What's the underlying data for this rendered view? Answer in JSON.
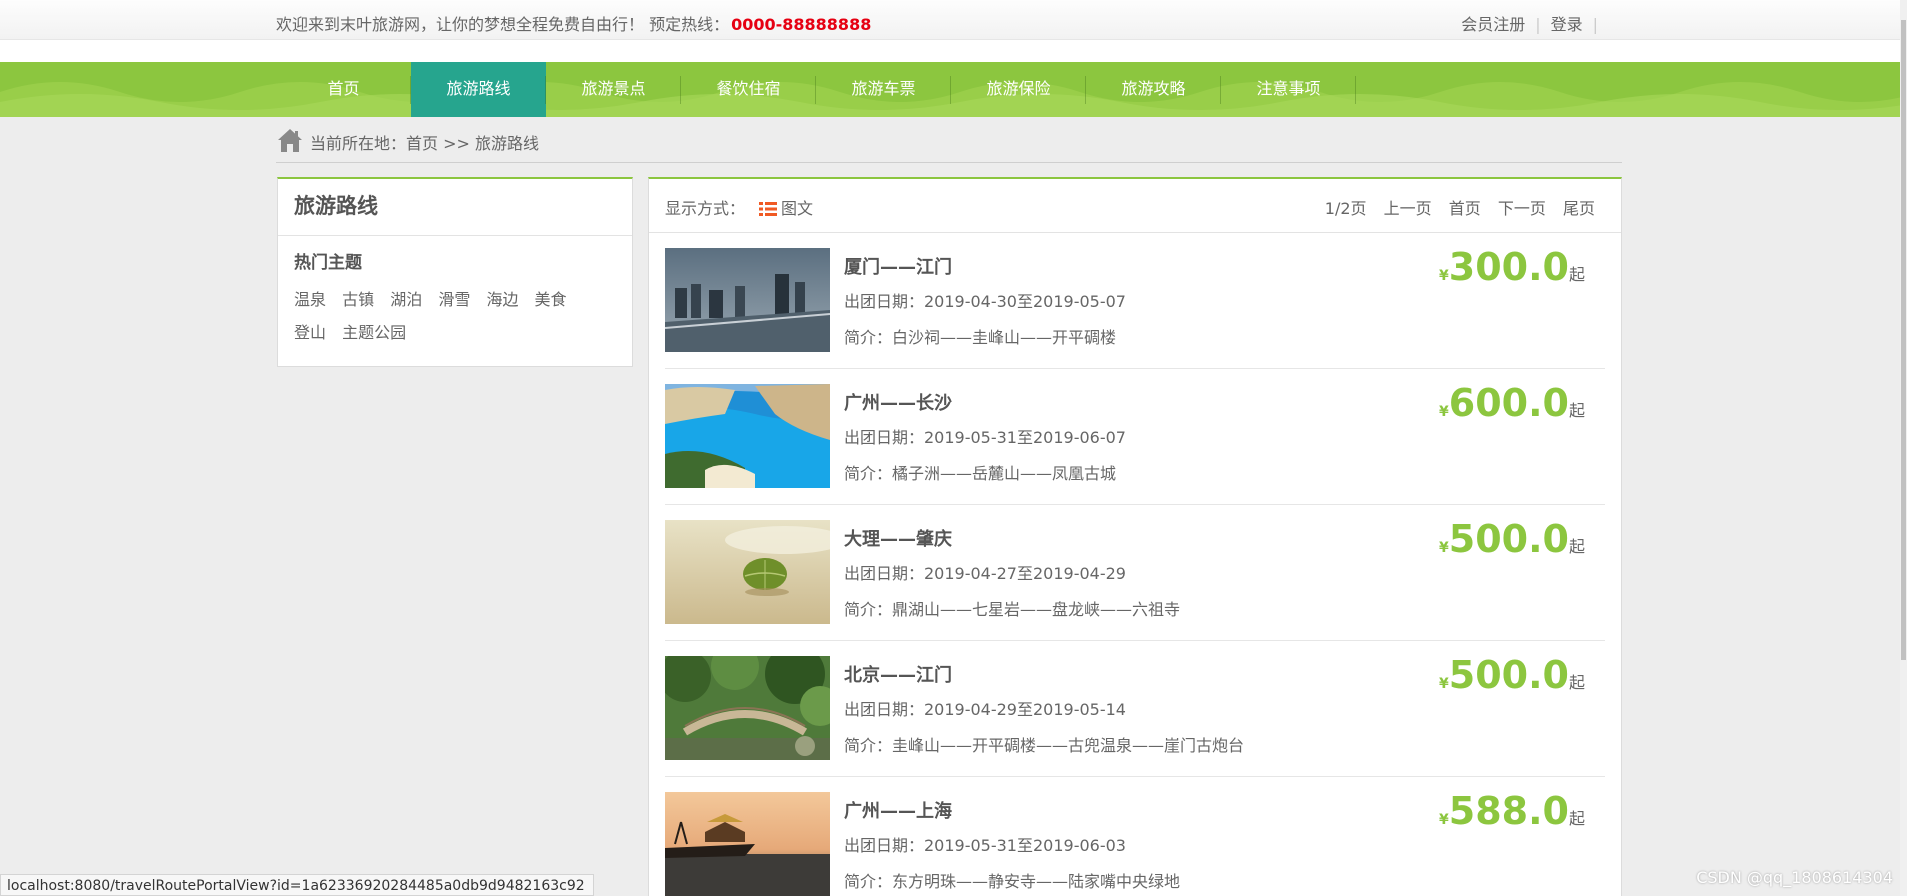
{
  "topbar": {
    "welcome": "欢迎来到末叶旅游网，让你的梦想全程免费自由行！  预定热线：",
    "hotline": "0000-88888888",
    "register": "会员注册",
    "login": "登录",
    "separator": "|"
  },
  "nav": {
    "items": [
      {
        "label": "首页"
      },
      {
        "label": "旅游路线"
      },
      {
        "label": "旅游景点"
      },
      {
        "label": "餐饮住宿"
      },
      {
        "label": "旅游车票"
      },
      {
        "label": "旅游保险"
      },
      {
        "label": "旅游攻略"
      },
      {
        "label": "注意事项"
      }
    ],
    "active": "旅游路线"
  },
  "breadcrumb": {
    "text": "当前所在地：首页 >> 旅游路线",
    "icon": "home-icon"
  },
  "sidebar": {
    "title": "旅游路线",
    "subtitle": "热门主题",
    "tags": [
      "温泉",
      "古镇",
      "湖泊",
      "滑雪",
      "海边",
      "美食",
      "登山",
      "主题公园"
    ]
  },
  "main": {
    "view_label": "显示方式：",
    "view_mode": "图文",
    "pager": {
      "page": "1/2页",
      "prev": "上一页",
      "first": "首页",
      "next": "下一页",
      "last": "尾页"
    },
    "routes": [
      {
        "title": "厦门——江门",
        "date": "出团日期：2019-04-30至2019-05-07",
        "desc": "简介：白沙祠——圭峰山——开平碉楼",
        "currency": "¥",
        "price": "300.0",
        "suffix": "起",
        "image": "city-bridge-photo"
      },
      {
        "title": "广州——长沙",
        "date": "出团日期：2019-05-31至2019-06-07",
        "desc": "简介：橘子洲——岳麓山——凤凰古城",
        "currency": "¥",
        "price": "600.0",
        "suffix": "起",
        "image": "beach-cove-photo"
      },
      {
        "title": "大理——肇庆",
        "date": "出团日期：2019-04-27至2019-04-29",
        "desc": "简介：鼎湖山——七星岩——盘龙峡——六祖寺",
        "currency": "¥",
        "price": "500.0",
        "suffix": "起",
        "image": "leaf-on-sand-photo"
      },
      {
        "title": "北京——江门",
        "date": "出团日期：2019-04-29至2019-05-14",
        "desc": "简介：圭峰山——开平碉楼——古兜温泉——崖门古炮台",
        "currency": "¥",
        "price": "500.0",
        "suffix": "起",
        "image": "garden-bridge-photo"
      },
      {
        "title": "广州——上海",
        "date": "出团日期：2019-05-31至2019-06-03",
        "desc": "简介：东方明珠——静安寺——陆家嘴中央绿地",
        "currency": "¥",
        "price": "588.0",
        "suffix": "起",
        "image": "boat-sunset-photo"
      }
    ]
  },
  "status_url": "localhost:8080/travelRoutePortalView?id=1a62336920284485a0db9d9482163c92",
  "watermark": "CSDN @qq_1808614304",
  "colors": {
    "accent_green": "#8cc63f",
    "nav_active": "#26a58e",
    "hotline_red": "#e60012"
  }
}
